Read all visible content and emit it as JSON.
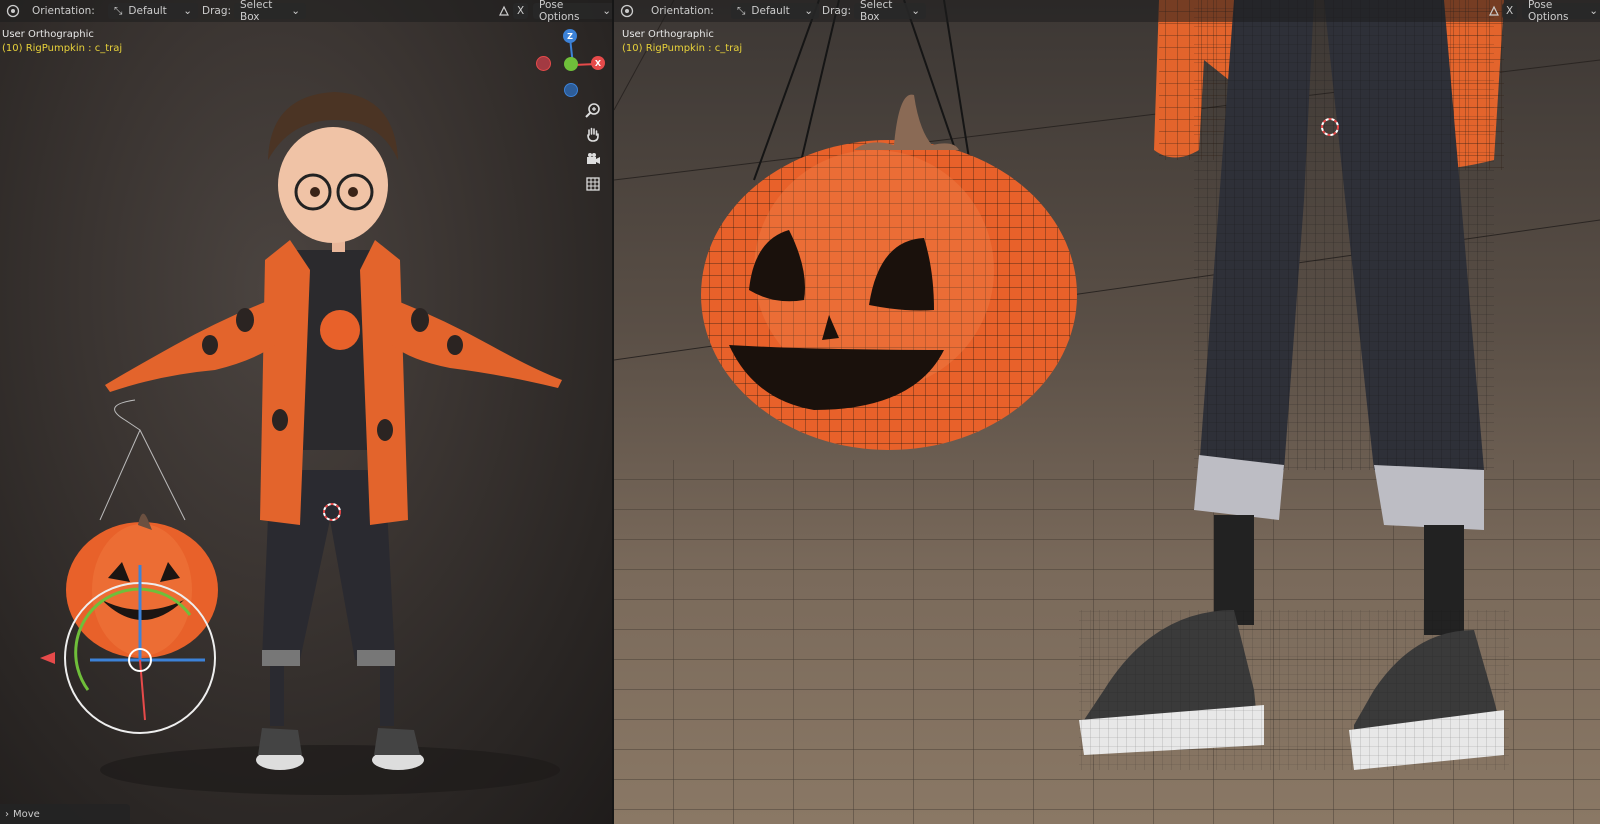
{
  "left": {
    "header": {
      "orientation_label": "Orientation:",
      "orientation_value": "Default",
      "drag_label": "Drag:",
      "drag_value": "Select Box",
      "x_label": "X",
      "pose_options": "Pose Options"
    },
    "viewport_mode": "User Orthographic",
    "active_object": "(10) RigPumpkin : c_traj",
    "gizmo": {
      "z": "Z",
      "x": "X"
    },
    "operator_panel": "Move"
  },
  "right": {
    "header": {
      "orientation_label": "Orientation:",
      "orientation_value": "Default",
      "drag_label": "Drag:",
      "drag_value": "Select Box",
      "x_label": "X",
      "pose_options": "Pose Options"
    },
    "viewport_mode": "User Orthographic",
    "active_object": "(10) RigPumpkin : c_traj"
  },
  "colors": {
    "pumpkin": "#e8612a",
    "jacket": "#e3642c",
    "axis_x": "#e64a4a",
    "axis_y": "#6fbf3a",
    "axis_z": "#3c82d8",
    "active_text": "#e8d23a"
  },
  "icons": [
    "editor-type-icon",
    "transform-orientation-icon",
    "gizmo-toggle-icon",
    "zoom-icon",
    "hand-pan-icon",
    "camera-icon",
    "grid-icon",
    "chevron-down-icon",
    "chevron-right-icon"
  ]
}
